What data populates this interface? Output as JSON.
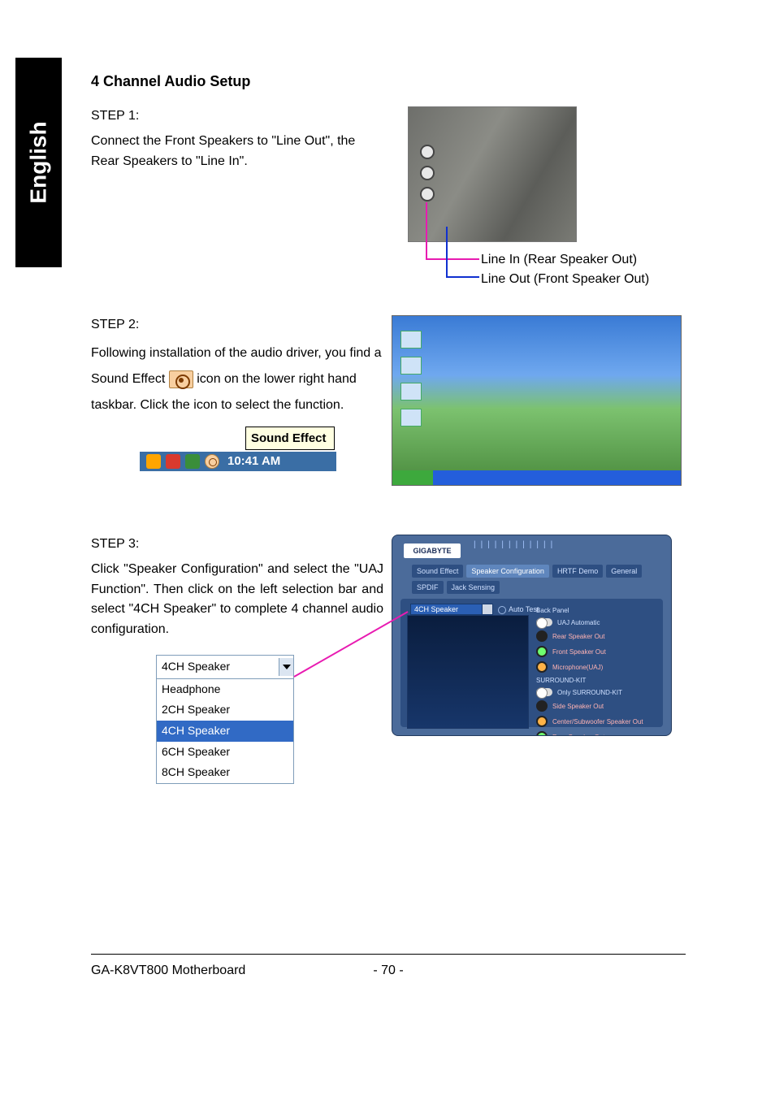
{
  "language_tab": "English",
  "section_title": "4 Channel Audio Setup",
  "step1": {
    "label": "STEP 1:",
    "text": "Connect the Front Speakers to \"Line Out\", the Rear Speakers to \"Line In\".",
    "callout1": "Line In (Rear Speaker Out)",
    "callout2": "Line Out (Front Speaker Out)"
  },
  "step2": {
    "label": "STEP 2:",
    "text_before_icon": "Following installation of the audio driver, you find a Sound Effect ",
    "text_after_icon": " icon on the lower right hand taskbar. Click the icon to select the function.",
    "tooltip": "Sound Effect",
    "tray_time": "10:41 AM"
  },
  "step3": {
    "label": "STEP 3:",
    "text": "Click \"Speaker Configuration\" and select the \"UAJ Function\".  Then click on the left selection bar and select \"4CH Speaker\" to complete 4 channel audio configuration.",
    "dropdown_value": "4CH Speaker",
    "dropdown_options": [
      "Headphone",
      "2CH Speaker",
      "4CH Speaker",
      "6CH Speaker",
      "8CH Speaker"
    ],
    "selected_index": 2
  },
  "sound_panel": {
    "logo": "GIGABYTE",
    "title_dots": "||||||||||||",
    "tabs": [
      "Sound Effect",
      "Speaker Configuration",
      "HRTF Demo",
      "General",
      "SPDIF",
      "Jack Sensing"
    ],
    "active_tab_index": 1,
    "speaker_select": "4CH Speaker",
    "auto_test": "Auto Test",
    "back_panel_label": "Back Panel",
    "uaj_row": "UAJ Automatic",
    "rows_back": [
      "Rear Speaker Out",
      "Front Speaker Out",
      "Microphone(UAJ)"
    ],
    "surround_kit_label": "SURROUND-KIT",
    "only_surround": "Only SURROUND-KIT",
    "rows_surround": [
      "Side Speaker Out",
      "Center/Subwoofer Speaker Out",
      "Rear Speaker Out"
    ]
  },
  "footer": {
    "left": "GA-K8VT800 Motherboard",
    "page": "- 70 -"
  }
}
